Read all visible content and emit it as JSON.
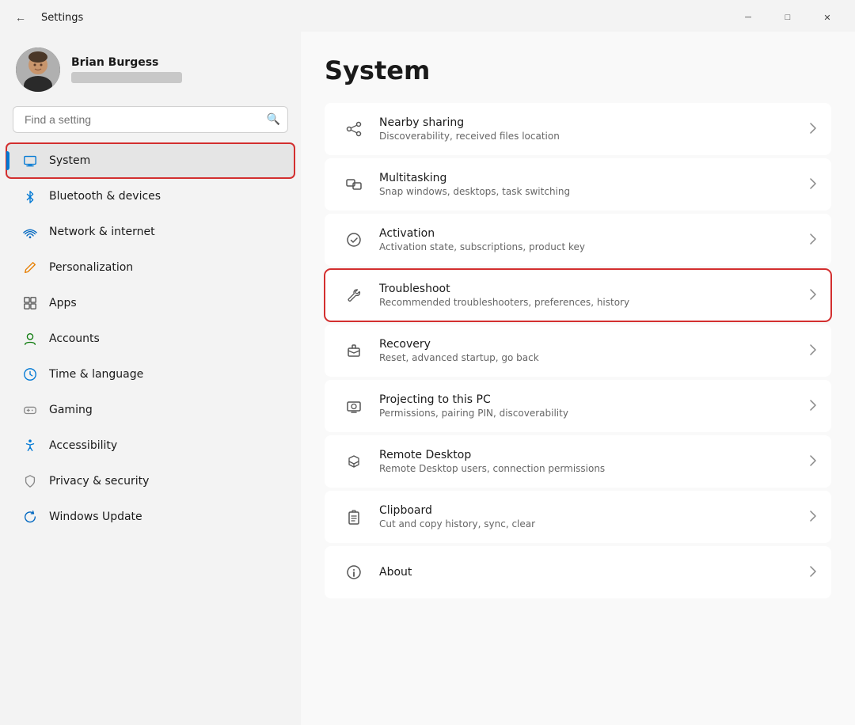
{
  "titlebar": {
    "back_label": "←",
    "title": "Settings",
    "minimize_label": "─",
    "maximize_label": "□",
    "close_label": "✕"
  },
  "sidebar": {
    "user": {
      "name": "Brian Burgess",
      "email_placeholder": ""
    },
    "search": {
      "placeholder": "Find a setting"
    },
    "nav_items": [
      {
        "id": "system",
        "label": "System",
        "icon": "🖥",
        "active": true
      },
      {
        "id": "bluetooth",
        "label": "Bluetooth & devices",
        "icon": "⊛",
        "active": false
      },
      {
        "id": "network",
        "label": "Network & internet",
        "icon": "◈",
        "active": false
      },
      {
        "id": "personalization",
        "label": "Personalization",
        "icon": "✏",
        "active": false
      },
      {
        "id": "apps",
        "label": "Apps",
        "icon": "⊞",
        "active": false
      },
      {
        "id": "accounts",
        "label": "Accounts",
        "icon": "👤",
        "active": false
      },
      {
        "id": "time",
        "label": "Time & language",
        "icon": "🌐",
        "active": false
      },
      {
        "id": "gaming",
        "label": "Gaming",
        "icon": "🎮",
        "active": false
      },
      {
        "id": "accessibility",
        "label": "Accessibility",
        "icon": "♿",
        "active": false
      },
      {
        "id": "privacy",
        "label": "Privacy & security",
        "icon": "🛡",
        "active": false
      },
      {
        "id": "update",
        "label": "Windows Update",
        "icon": "↻",
        "active": false
      }
    ]
  },
  "content": {
    "title": "System",
    "settings": [
      {
        "id": "nearby-sharing",
        "icon": "share",
        "title": "Nearby sharing",
        "desc": "Discoverability, received files location",
        "highlighted": false
      },
      {
        "id": "multitasking",
        "icon": "multitask",
        "title": "Multitasking",
        "desc": "Snap windows, desktops, task switching",
        "highlighted": false
      },
      {
        "id": "activation",
        "icon": "activation",
        "title": "Activation",
        "desc": "Activation state, subscriptions, product key",
        "highlighted": false
      },
      {
        "id": "troubleshoot",
        "icon": "wrench",
        "title": "Troubleshoot",
        "desc": "Recommended troubleshooters, preferences, history",
        "highlighted": true
      },
      {
        "id": "recovery",
        "icon": "recovery",
        "title": "Recovery",
        "desc": "Reset, advanced startup, go back",
        "highlighted": false
      },
      {
        "id": "projecting",
        "icon": "projecting",
        "title": "Projecting to this PC",
        "desc": "Permissions, pairing PIN, discoverability",
        "highlighted": false
      },
      {
        "id": "remote-desktop",
        "icon": "remote",
        "title": "Remote Desktop",
        "desc": "Remote Desktop users, connection permissions",
        "highlighted": false
      },
      {
        "id": "clipboard",
        "icon": "clipboard",
        "title": "Clipboard",
        "desc": "Cut and copy history, sync, clear",
        "highlighted": false
      },
      {
        "id": "about",
        "icon": "info",
        "title": "About",
        "desc": "",
        "highlighted": false
      }
    ]
  }
}
